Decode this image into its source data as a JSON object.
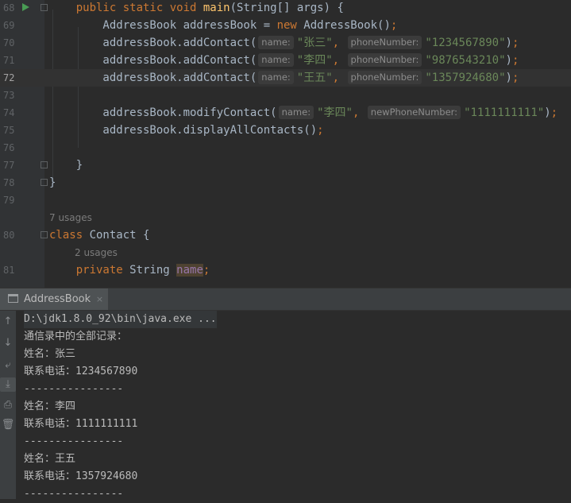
{
  "editor": {
    "lines": [
      {
        "number": "68",
        "segments": [
          {
            "t": "    "
          },
          {
            "t": "public static void ",
            "c": "kw"
          },
          {
            "t": "main",
            "c": "fn"
          },
          {
            "t": "(String[] args) {"
          }
        ]
      },
      {
        "number": "69",
        "segments": [
          {
            "t": "        AddressBook addressBook = "
          },
          {
            "t": "new ",
            "c": "kw"
          },
          {
            "t": "AddressBook()"
          },
          {
            "t": ";",
            "c": "kw"
          }
        ]
      },
      {
        "number": "70",
        "segments": [
          {
            "t": "        addressBook.addContact("
          },
          {
            "t": "name:",
            "c": "hint"
          },
          {
            "t": "\"张三\"",
            "c": "str"
          },
          {
            "t": ", ",
            "c": "kw"
          },
          {
            "t": "phoneNumber:",
            "c": "hint"
          },
          {
            "t": "\"1234567890\"",
            "c": "str"
          },
          {
            "t": ")"
          },
          {
            "t": ";",
            "c": "kw"
          }
        ]
      },
      {
        "number": "71",
        "segments": [
          {
            "t": "        addressBook.addContact("
          },
          {
            "t": "name:",
            "c": "hint"
          },
          {
            "t": "\"李四\"",
            "c": "str"
          },
          {
            "t": ", ",
            "c": "kw"
          },
          {
            "t": "phoneNumber:",
            "c": "hint"
          },
          {
            "t": "\"9876543210\"",
            "c": "str"
          },
          {
            "t": ")"
          },
          {
            "t": ";",
            "c": "kw"
          }
        ]
      },
      {
        "number": "72",
        "current": true,
        "segments": [
          {
            "t": "        addressBook.addContact("
          },
          {
            "t": "name:",
            "c": "hint"
          },
          {
            "t": "\"王五\"",
            "c": "str"
          },
          {
            "t": ", ",
            "c": "kw"
          },
          {
            "t": "phoneNumber:",
            "c": "hint"
          },
          {
            "t": "\"1357924680\"",
            "c": "str"
          },
          {
            "t": ")"
          },
          {
            "t": ";",
            "c": "kw"
          }
        ]
      },
      {
        "number": "73",
        "segments": []
      },
      {
        "number": "74",
        "segments": [
          {
            "t": "        addressBook.modifyContact("
          },
          {
            "t": "name:",
            "c": "hint"
          },
          {
            "t": "\"李四\"",
            "c": "str"
          },
          {
            "t": ", ",
            "c": "kw"
          },
          {
            "t": "newPhoneNumber:",
            "c": "hint"
          },
          {
            "t": "\"1111111111\"",
            "c": "str"
          },
          {
            "t": ")"
          },
          {
            "t": ";",
            "c": "kw"
          }
        ]
      },
      {
        "number": "75",
        "segments": [
          {
            "t": "        addressBook.displayAllContacts()"
          },
          {
            "t": ";",
            "c": "kw"
          }
        ]
      },
      {
        "number": "76",
        "segments": []
      },
      {
        "number": "77",
        "segments": [
          {
            "t": "    }"
          }
        ]
      },
      {
        "number": "78",
        "segments": [
          {
            "t": "}"
          }
        ]
      },
      {
        "number": "79",
        "segments": []
      },
      {
        "usages": "7 usages",
        "indent": 0
      },
      {
        "number": "80",
        "segments": [
          {
            "t": "class ",
            "c": "kw"
          },
          {
            "t": "Contact {"
          }
        ]
      },
      {
        "usages": "2 usages",
        "indent": 1
      },
      {
        "number": "81",
        "segments": [
          {
            "t": "    "
          },
          {
            "t": "private ",
            "c": "kw"
          },
          {
            "t": "String "
          },
          {
            "t": "name",
            "c": "field"
          },
          {
            "t": ";",
            "c": "kw"
          }
        ]
      }
    ]
  },
  "run_panel": {
    "tab_label": "AddressBook",
    "close_glyph": "×",
    "sidebar_icons": [
      "arrow-up-icon",
      "arrow-down-icon",
      "soft-wrap-icon",
      "scroll-to-end-icon",
      "print-icon",
      "trash-icon"
    ],
    "console_lines": [
      "D:\\jdk1.8.0_92\\bin\\java.exe ...",
      "通信录中的全部记录：",
      "姓名：张三",
      "联系电话：1234567890",
      "----------------",
      "姓名：李四",
      "联系电话：1111111111",
      "----------------",
      "姓名：王五",
      "联系电话：1357924680",
      "----------------"
    ]
  },
  "colors": {
    "keyword": "#cc7832",
    "string": "#6a8759",
    "method": "#ffc66d",
    "field": "#9876aa",
    "text": "#a9b7c6",
    "run_icon": "#499c54"
  }
}
